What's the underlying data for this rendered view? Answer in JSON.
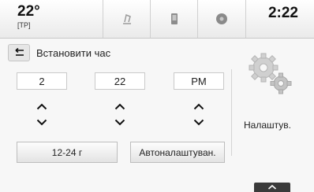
{
  "status": {
    "temperature": "22°",
    "temperature_mode": "[TP]",
    "clock": "2:22"
  },
  "tabs": [
    {
      "icon": "music-note-icon"
    },
    {
      "icon": "phone-icon"
    },
    {
      "icon": "navigation-icon"
    }
  ],
  "header": {
    "back_icon": "back-arrow-icon",
    "title": "Встановити час"
  },
  "time": {
    "hour": "2",
    "minute": "22",
    "period": "PM"
  },
  "buttons": {
    "format_toggle": "12-24 г",
    "auto_set": "Автоналаштуван."
  },
  "settings": {
    "icon": "gears-icon",
    "label": "Налаштув."
  },
  "bottom": {
    "icon": "chevron-up-icon"
  }
}
